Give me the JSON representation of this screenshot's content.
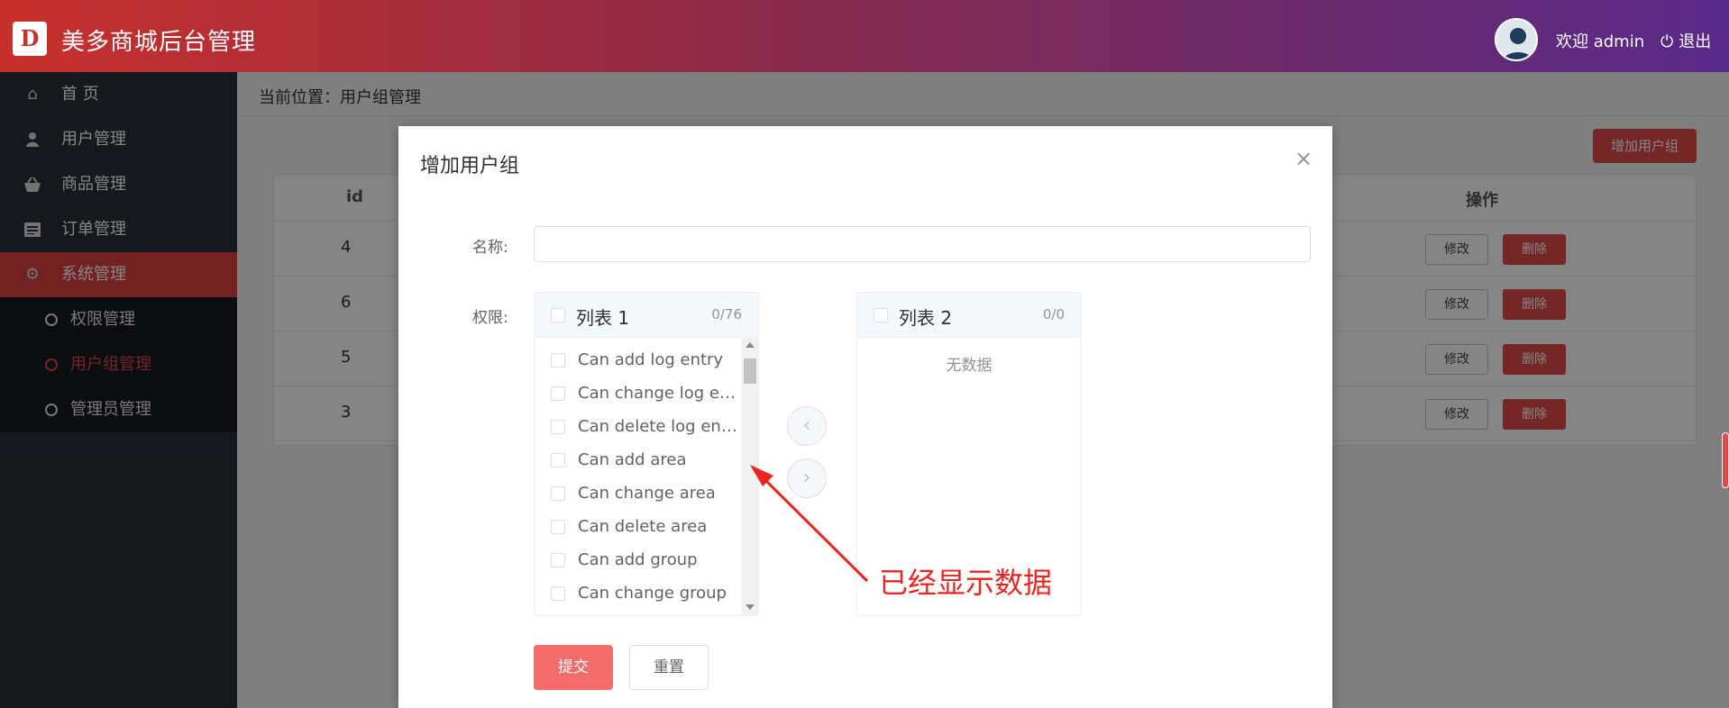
{
  "header": {
    "logo_text": "D",
    "title": "美多商城后台管理",
    "welcome": "欢迎 admin",
    "logout": "退出"
  },
  "sidebar": {
    "items": [
      {
        "label": "首 页",
        "icon": "home-icon"
      },
      {
        "label": "用户管理",
        "icon": "user-icon"
      },
      {
        "label": "商品管理",
        "icon": "basket-icon"
      },
      {
        "label": "订单管理",
        "icon": "list-icon"
      },
      {
        "label": "系统管理",
        "icon": "gear-icon",
        "active": true
      }
    ],
    "sub_items": [
      {
        "label": "权限管理"
      },
      {
        "label": "用户组管理",
        "active": true
      },
      {
        "label": "管理员管理"
      }
    ]
  },
  "main": {
    "breadcrumb": "当前位置：用户组管理",
    "add_button": "增加用户组",
    "table": {
      "headers": {
        "id": "id",
        "ops": "操作"
      },
      "rows": [
        {
          "id": "4"
        },
        {
          "id": "6"
        },
        {
          "id": "5"
        },
        {
          "id": "3"
        }
      ],
      "edit_label": "修改",
      "delete_label": "删除"
    }
  },
  "dialog": {
    "title": "增加用户组",
    "close": "×",
    "name_label": "名称:",
    "name_value": "",
    "perm_label": "权限:",
    "list1": {
      "title": "列表 1",
      "count": "0/76",
      "items": [
        "Can add log entry",
        "Can change log entry",
        "Can delete log entry",
        "Can add area",
        "Can change area",
        "Can delete area",
        "Can add group",
        "Can change group"
      ]
    },
    "list2": {
      "title": "列表 2",
      "count": "0/0",
      "empty": "无数据"
    },
    "arrow_left": "‹",
    "arrow_right": "›",
    "submit": "提交",
    "reset": "重置"
  },
  "annotation": {
    "text": "已经显示数据",
    "color": "#e8251f"
  },
  "colors": {
    "accent": "#e04a4a",
    "sidebar_bg": "#2a2e36"
  }
}
